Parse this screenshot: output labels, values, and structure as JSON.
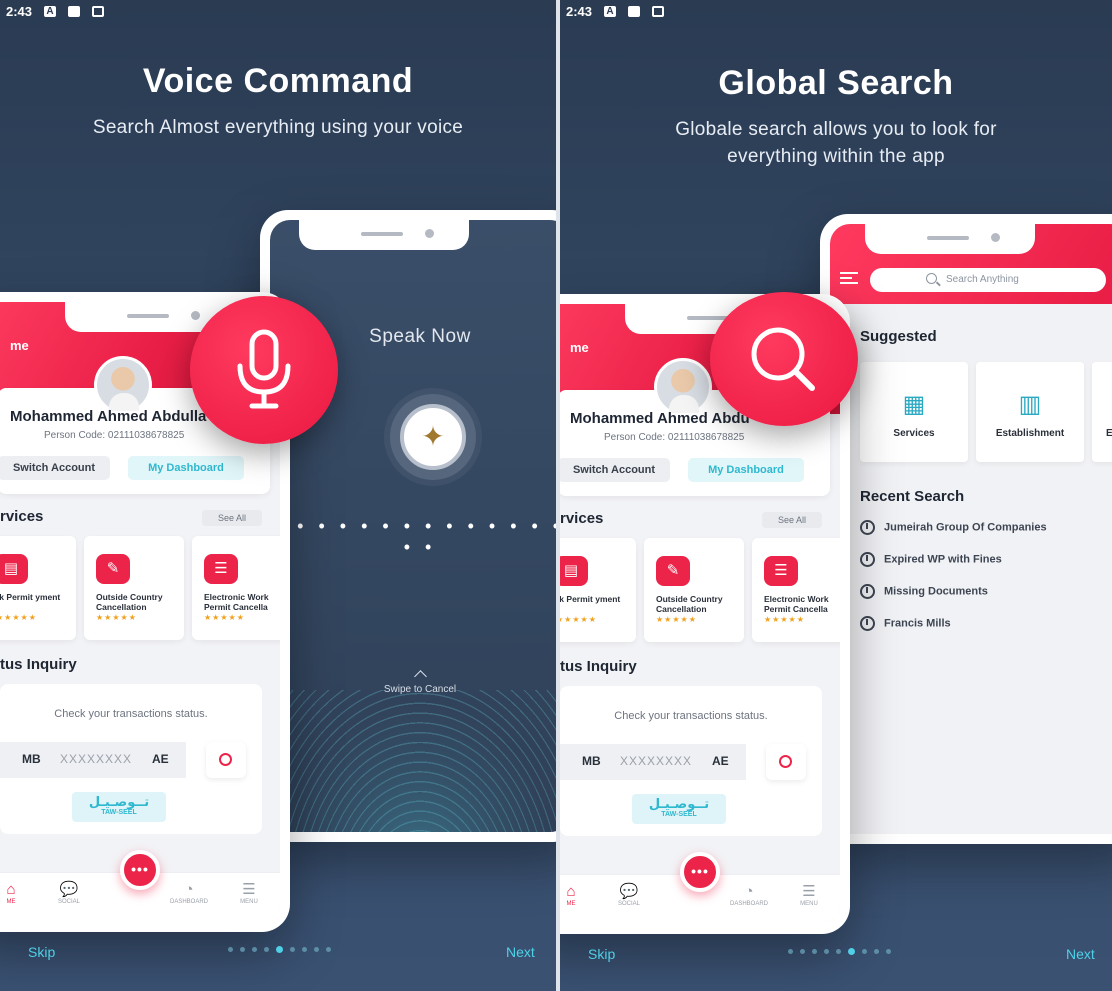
{
  "status_bar": {
    "time": "2:43"
  },
  "left_slide": {
    "title": "Voice Command",
    "subtitle": "Search Almost everything using your voice",
    "profile": {
      "home_label": "me",
      "name": "Mohammed Ahmed Abdulla",
      "person_code": "Person Code: 02111038678825",
      "switch_account": "Switch Account",
      "my_dashboard": "My Dashboard"
    },
    "services": {
      "heading": "rvices",
      "see_all": "See All",
      "items": [
        {
          "title": "rk Permit yment",
          "icon": "document-icon"
        },
        {
          "title": "Outside Country Cancellation",
          "icon": "document-edit-icon"
        },
        {
          "title": "Electronic Work Permit Cancella",
          "icon": "document-list-icon"
        }
      ],
      "stars": "★★★★★"
    },
    "status_inquiry": {
      "heading": "tus Inquiry",
      "message": "Check your transactions status.",
      "prefix": "MB",
      "placeholder": "XXXXXXXX",
      "suffix": "AE",
      "logo_ar": "تــوصـيـل",
      "logo_en": "TAW-SEEL"
    },
    "tabs": [
      "ME",
      "SOCIAL",
      "DASHBOARD",
      "MENU"
    ],
    "fab": "•••",
    "voice": {
      "speak_now": "Speak Now",
      "dots": "• • • • • • • • • • • • • • • •",
      "swipe": "Swipe to Cancel"
    },
    "nav": {
      "skip": "Skip",
      "next": "Next",
      "page_count": 9,
      "active_page": 4
    }
  },
  "right_slide": {
    "title": "Global Search",
    "subtitle_line1": "Globale search allows you to look for",
    "subtitle_line2": "everything within the app",
    "search_placeholder": "Search Anything",
    "suggested_heading": "Suggested",
    "suggested": [
      {
        "label": "Services",
        "icon": "grid-icon"
      },
      {
        "label": "Establishment",
        "icon": "building-icon"
      },
      {
        "label": "E",
        "icon": "building-icon"
      }
    ],
    "recent_heading": "Recent Search",
    "recent": [
      "Jumeirah Group Of Companies",
      "Expired WP with Fines",
      "Missing Documents",
      "Francis Mills"
    ],
    "profile": {
      "home_label": "me",
      "name": "Mohammed Ahmed Abdu",
      "person_code": "Person Code: 02111038678825",
      "switch_account": "Switch Account",
      "my_dashboard": "My Dashboard"
    },
    "services_heading": "rvices",
    "see_all": "See All",
    "status_heading": "tus Inquiry",
    "nav": {
      "skip": "Skip",
      "next": "Next",
      "page_count": 9,
      "active_page": 5
    }
  },
  "colors": {
    "accent_red": "#ed2449",
    "accent_cyan": "#4fd0e6",
    "bg_navy": "#2e4058"
  }
}
